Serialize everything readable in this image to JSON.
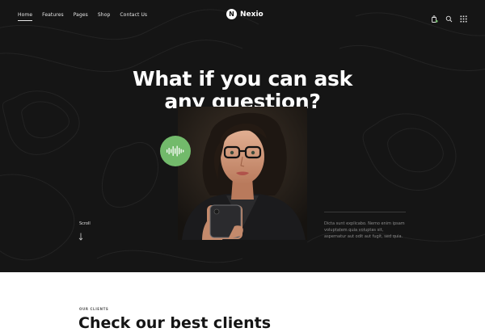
{
  "nav": {
    "items": [
      {
        "label": "Home",
        "active": true
      },
      {
        "label": "Features"
      },
      {
        "label": "Pages"
      },
      {
        "label": "Shop"
      },
      {
        "label": "Contact Us"
      }
    ]
  },
  "brand": {
    "mark": "N",
    "name": "Nexio"
  },
  "header_icons": [
    "cart-icon",
    "search-icon",
    "grid-menu-icon"
  ],
  "hero": {
    "headline_line1": "What if you can ask",
    "headline_line2": "any question?",
    "scroll_label": "Scroll",
    "side_text": "Dicta sunt explicabo. Nemo enim ipsam voluptatem quia voluptas sit, aspernatur aut odit aut fugit, sed quia."
  },
  "clients": {
    "eyebrow": "OUR CLIENTS",
    "title": "Check our best clients"
  },
  "colors": {
    "hero_background": "#151515",
    "accent_green": "#72ba6b",
    "text_light": "#ffffff"
  }
}
